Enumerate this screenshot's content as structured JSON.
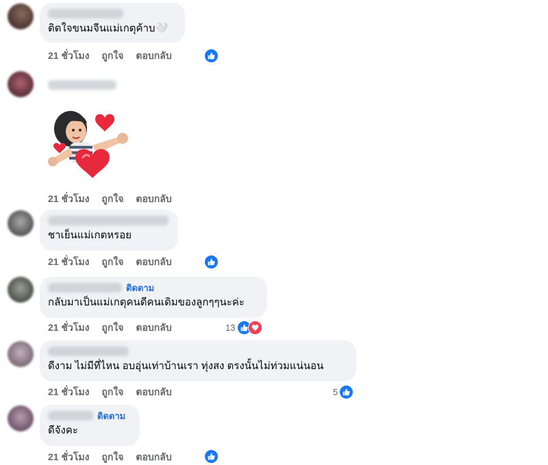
{
  "action_labels": {
    "time": "21 ชั่วโมง",
    "like": "ถูกใจ",
    "reply": "ตอบกลับ"
  },
  "follow_label": "ติดตาม",
  "comments": [
    {
      "text": "ติดใจขนมจีนแม่เกตุค้าบ🤍",
      "reaction_count": "",
      "reactions": [
        "like"
      ]
    },
    {
      "text": "",
      "sticker": "heart-girl-sticker",
      "reaction_count": "",
      "reactions": []
    },
    {
      "text": "ชาเย็นแม่เกตหรอย",
      "reaction_count": "",
      "reactions": [
        "like"
      ]
    },
    {
      "text": "กลับมาเป็นแม่เกตุคนดีคนเดิมของลูกๆๆนะค่ะ",
      "reaction_count": "13",
      "reactions": [
        "like",
        "love"
      ]
    },
    {
      "text": "ดีงาม ไม่มีที่ไหน อบอุ่นเท่าบ้านเรา ทุ่งสง ตรงนั้นไม่ท่วมแน่นอน",
      "reaction_count": "5",
      "reactions": [
        "like"
      ]
    },
    {
      "text": "ดีจังคะ",
      "reaction_count": "",
      "reactions": [
        "like"
      ]
    }
  ],
  "colors": {
    "like": "#1877f2",
    "love": "#f33e58",
    "follow": "#216fdb",
    "bubble": "#f0f2f5",
    "meta": "#65676b"
  }
}
